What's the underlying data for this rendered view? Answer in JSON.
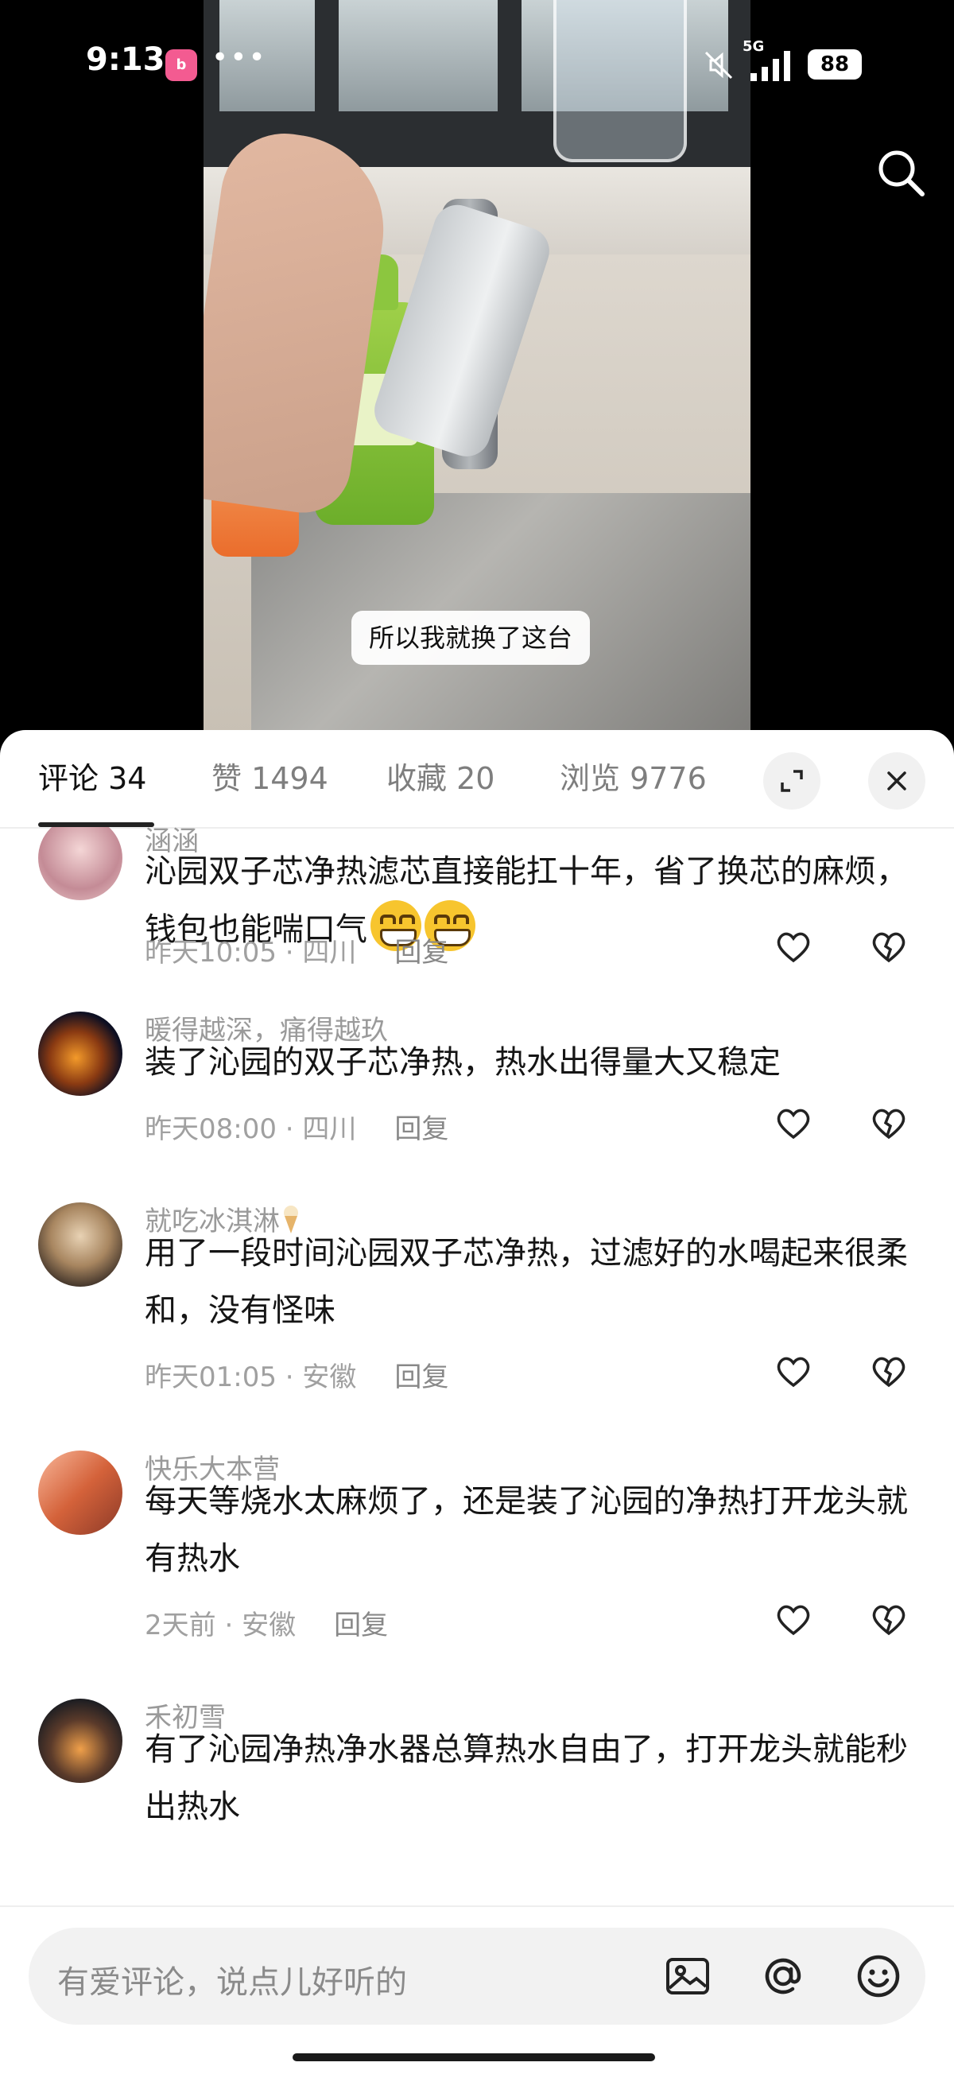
{
  "status_bar": {
    "time": "9:13",
    "app_badge": "bilibili",
    "more": "•••",
    "network": "5G",
    "battery": "88"
  },
  "video": {
    "caption": "所以我就换了这台"
  },
  "tabs": [
    {
      "label": "评论 34",
      "active": true
    },
    {
      "label": "赞 1494"
    },
    {
      "label": "收藏 20"
    },
    {
      "label": "浏览 9776"
    }
  ],
  "comments": [
    {
      "user": "涵涵",
      "text": "沁园双子芯净热滤芯直接能扛十年，省了换芯的麻烦，钱包也能喘口气",
      "time": "昨天10:05",
      "location": "四川",
      "reply": "回复",
      "emoji_count": 2
    },
    {
      "user": "暖得越深，痛得越玖",
      "text": "装了沁园的双子芯净热，热水出得量大又稳定",
      "time": "昨天08:00",
      "location": "四川",
      "reply": "回复"
    },
    {
      "user": "就吃冰淇淋",
      "text": "用了一段时间沁园双子芯净热，过滤好的水喝起来很柔和，没有怪味",
      "time": "昨天01:05",
      "location": "安徽",
      "reply": "回复"
    },
    {
      "user": "快乐大本营",
      "text": "每天等烧水太麻烦了，还是装了沁园的净热打开龙头就有热水",
      "time": "2天前",
      "location": "安徽",
      "reply": "回复"
    },
    {
      "user": "禾初雪",
      "text": "有了沁园净热净水器总算热水自由了，打开龙头就能秒出热水",
      "time": "",
      "location": "",
      "reply": ""
    }
  ],
  "input": {
    "placeholder": "有爱评论，说点儿好听的"
  },
  "icons": {
    "search": "search-icon",
    "expand": "expand-icon",
    "close": "close-icon",
    "like": "heart-icon",
    "dislike": "broken-heart-icon",
    "image": "image-icon",
    "mention": "at-icon",
    "emoji": "emoji-icon"
  }
}
